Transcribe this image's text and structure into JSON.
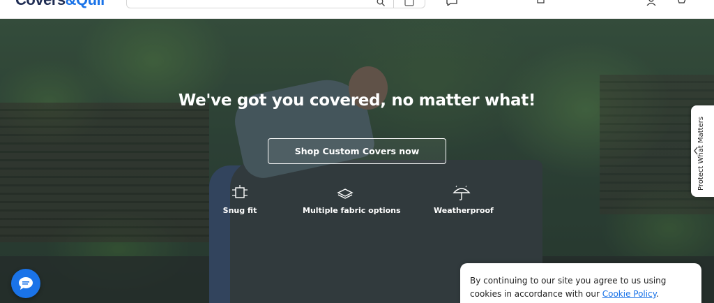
{
  "header": {
    "logo_main": "Covers",
    "logo_accent": "&Quil"
  },
  "hero": {
    "title": "We've got you covered, no matter what!",
    "cta_label": "Shop Custom Covers now",
    "features": [
      {
        "label": "Snug fit",
        "icon": "snug-fit-icon"
      },
      {
        "label": "Multiple fabric options",
        "icon": "fabric-icon"
      },
      {
        "label": "Weatherproof",
        "icon": "umbrella-icon"
      }
    ]
  },
  "side_tab": {
    "label": "Protect What Matters",
    "icon": "chevron-left-icon"
  },
  "chat": {
    "icon": "chat-bubble-icon",
    "color": "#1a73e8"
  },
  "cookie_banner": {
    "text_prefix": "By continuing to our site you agree to us using cookies in accordance with our ",
    "link_text": "Cookie Policy",
    "text_suffix": "."
  },
  "colors": {
    "accent": "#1a73e8",
    "text_dark": "#222222",
    "hero_text": "#ffffff"
  }
}
